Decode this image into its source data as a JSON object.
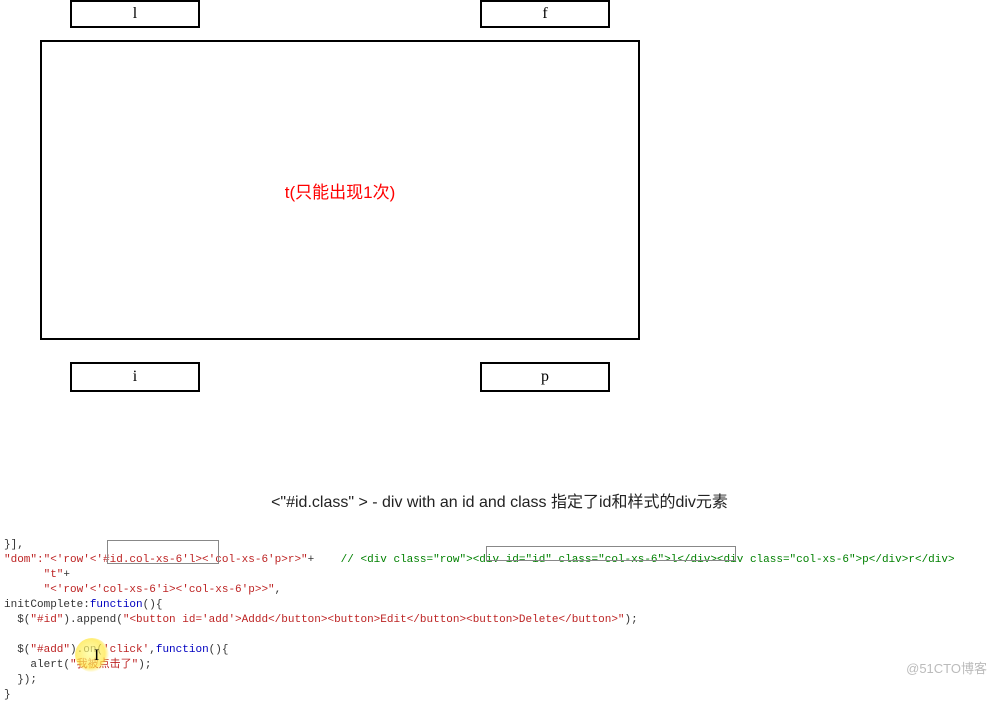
{
  "diagram": {
    "box_l": "l",
    "box_f": "f",
    "box_t": "t(只能出现1次)",
    "box_i": "i",
    "box_p": "p"
  },
  "caption": "<\"#id.class\" > - div with an id and class 指定了id和样式的div元素",
  "code": {
    "l1": "}],",
    "l2a": "\"dom\":",
    "l2b": "\"<'row'<'#id.col-xs-6'l><'col-xs-6'p>r>\"",
    "l2c": "+",
    "l2d": "// <div class=\"row\"><div id=\"id\" class=\"col-xs-6\">l</div><div class=\"col-xs-6\">p</div>r</div>",
    "l3a": "\"t\"",
    "l3b": "+",
    "l4": "\"<'row'<'col-xs-6'i><'col-xs-6'p>>\"",
    "l4b": ",",
    "l5a": "initComplete:",
    "l5b": "function",
    "l5c": "(){",
    "l6a": "  $(",
    "l6b": "\"#id\"",
    "l6c": ").append(",
    "l6d": "\"<button id='add'>Addd</button><button>Edit</button><button>Delete</button>\"",
    "l6e": ");",
    "l7": "",
    "l8a": "  $(",
    "l8b": "\"#add\"",
    "l8c": ").on(",
    "l8d": "'click'",
    "l8e": ",",
    "l8f": "function",
    "l8g": "(){",
    "l9a": "    alert(",
    "l9b": "\"我被点击了\"",
    "l9c": ");",
    "l10": "  });",
    "l11": "}"
  },
  "watermark": "@51CTO博客"
}
